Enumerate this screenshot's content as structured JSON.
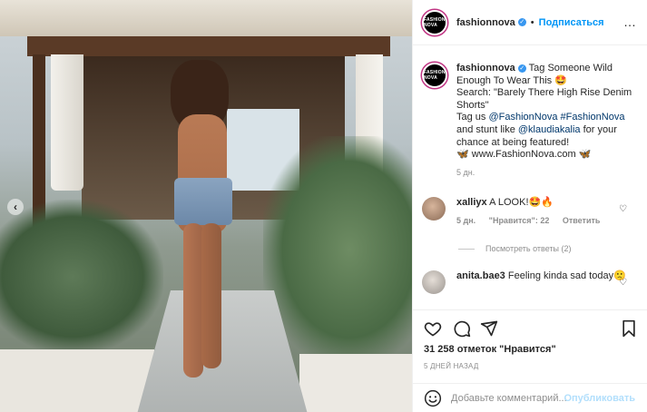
{
  "header": {
    "username": "fashionnova",
    "avatar_text": "FASHION NOVA",
    "separator": "•",
    "follow_label": "Подписаться",
    "more_icon": "…"
  },
  "caption": {
    "username": "fashionnova",
    "line1": "Tag Someone Wild Enough To Wear This 🤩",
    "line2": "Search: \"Barely There High Rise Denim Shorts\"",
    "line3_prefix": "Tag us ",
    "mention1": "@FashionNova",
    "hashtag1": "#FashionNova",
    "line3_mid": " and stunt like ",
    "mention2": "@klaudiakalia",
    "line3_suffix": " for your chance at being featured!",
    "line4": "🦋 www.FashionNova.com 🦋",
    "time": "5 дн."
  },
  "comments": [
    {
      "username": "xalliyx",
      "text": "A LOOK!🤩🔥",
      "time": "5 дн.",
      "likes": "\"Нравится\": 22",
      "reply": "Ответить",
      "view_replies": "Посмотреть ответы (2)"
    },
    {
      "username": "anita.bae3",
      "text": "Feeling kinda sad today🙁"
    }
  ],
  "actions": {
    "likes": "31 258 отметок \"Нравится\"",
    "date": "5 ДНЕЙ НАЗАД",
    "comment_placeholder": "Добавьте комментарий...",
    "post_label": "Опубликовать"
  },
  "colors": {
    "link": "#00376b",
    "follow": "#0095f6",
    "muted": "#8e8e8e",
    "verified": "#3897f0"
  },
  "icons": [
    "heart-icon",
    "comment-icon",
    "share-icon",
    "bookmark-icon",
    "emoji-icon",
    "chevron-left-icon",
    "verified-icon",
    "more-icon"
  ]
}
